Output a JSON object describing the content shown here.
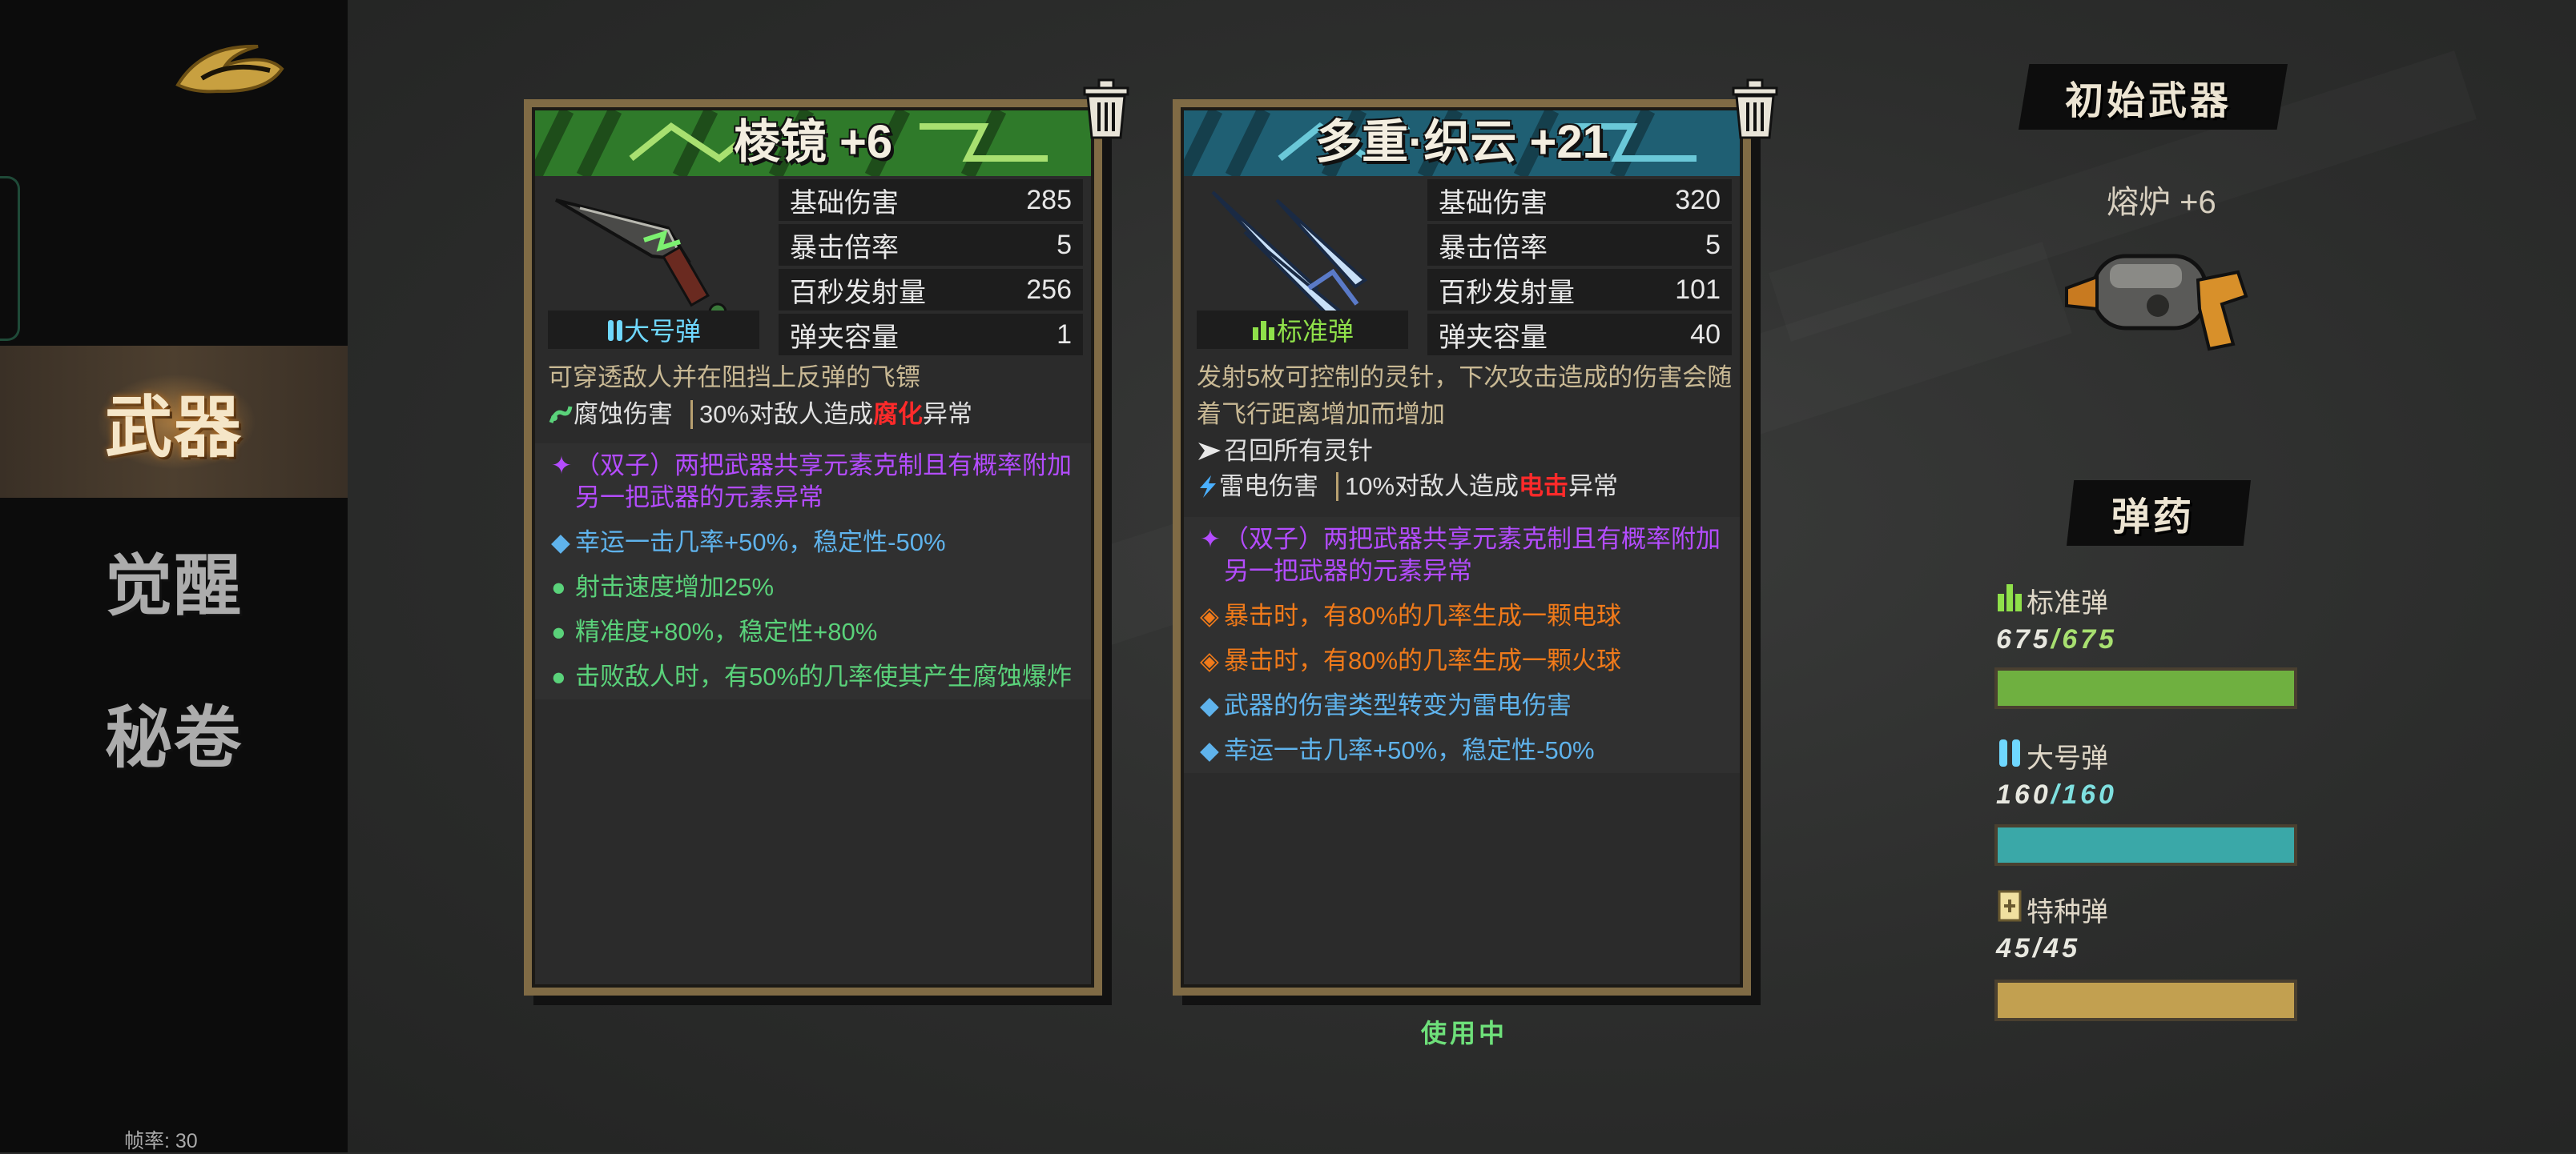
{
  "sidebar": {
    "tabs": [
      {
        "label": "武器",
        "active": true
      },
      {
        "label": "觉醒",
        "active": false
      },
      {
        "label": "秘卷",
        "active": false
      }
    ],
    "fps_label": "帧率: 30"
  },
  "weapons": [
    {
      "title": "棱镜 +6",
      "banner_color": "#2f7a2a",
      "ammo_type": "大号弹",
      "ammo_color": "#6fd8ff",
      "stats": [
        {
          "label": "基础伤害",
          "value": "285"
        },
        {
          "label": "暴击倍率",
          "value": "5"
        },
        {
          "label": "百秒发射量",
          "value": "256"
        },
        {
          "label": "弹夹容量",
          "value": "1"
        }
      ],
      "description": "可穿透敌人并在阻挡上反弹的飞镖",
      "damage": {
        "type": "腐蚀伤害",
        "effect_pre": "30%对敌人造成",
        "effect_key": "腐化",
        "effect_post": "异常"
      },
      "traits": [
        {
          "icon": "✦",
          "text": "（双子）两把武器共享元素克制且有概率附加另一把武器的元素异常",
          "color": "purple"
        },
        {
          "icon": "◆",
          "text": "幸运一击几率+50%，稳定性-50%",
          "color": "blue"
        },
        {
          "icon": "●",
          "text": "射击速度增加25%",
          "color": "green"
        },
        {
          "icon": "●",
          "text": "精准度+80%，稳定性+80%",
          "color": "green"
        },
        {
          "icon": "●",
          "text": "击败敌人时，有50%的几率使其产生腐蚀爆炸",
          "color": "green"
        }
      ]
    },
    {
      "title": "多重·织云 +21",
      "banner_color": "#1f5f73",
      "ammo_type": "标准弹",
      "ammo_color": "#8fe04a",
      "stats": [
        {
          "label": "基础伤害",
          "value": "320"
        },
        {
          "label": "暴击倍率",
          "value": "5"
        },
        {
          "label": "百秒发射量",
          "value": "101"
        },
        {
          "label": "弹夹容量",
          "value": "40"
        }
      ],
      "description": "发射5枚可控制的灵针，下次攻击造成的伤害会随着飞行距离增加而增加",
      "extra_line": "召回所有灵针",
      "damage": {
        "type": "雷电伤害",
        "effect_pre": "10%对敌人造成",
        "effect_key": "电击",
        "effect_post": "异常"
      },
      "traits": [
        {
          "icon": "✦",
          "text": "（双子）两把武器共享元素克制且有概率附加另一把武器的元素异常",
          "color": "purple"
        },
        {
          "icon": "◈",
          "text": "暴击时，有80%的几率生成一颗电球",
          "color": "orange"
        },
        {
          "icon": "◈",
          "text": "暴击时，有80%的几率生成一颗火球",
          "color": "orange"
        },
        {
          "icon": "◆",
          "text": "武器的伤害类型转变为雷电伤害",
          "color": "blue"
        },
        {
          "icon": "◆",
          "text": "幸运一击几率+50%，稳定性-50%",
          "color": "blue"
        }
      ],
      "status": "使用中"
    }
  ],
  "initial_weapon": {
    "heading": "初始武器",
    "name": "熔炉 +6"
  },
  "ammo": {
    "heading": "弹药",
    "types": [
      {
        "label": "标准弹",
        "current": "675",
        "max": "675",
        "fill": 1.0,
        "color": "#6fb040",
        "text_color": "#a8e070"
      },
      {
        "label": "大号弹",
        "current": "160",
        "max": "160",
        "fill": 1.0,
        "color": "#3aa8a8",
        "text_color": "#7fe0e0"
      },
      {
        "label": "特种弹",
        "current": "45",
        "max": "45",
        "fill": 1.0,
        "color": "#c2a050",
        "text_color": "#e8e0c8"
      }
    ]
  }
}
